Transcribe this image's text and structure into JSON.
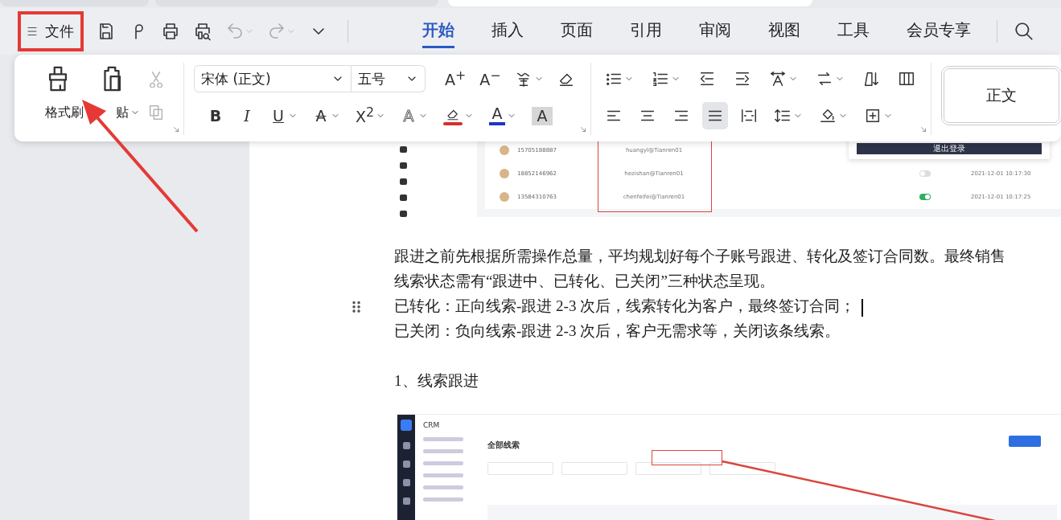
{
  "file_button": {
    "label": "文件",
    "highlighted": true
  },
  "quick_access": [
    {
      "kind": "save",
      "disabled": false
    },
    {
      "kind": "format",
      "disabled": false
    },
    {
      "kind": "print",
      "disabled": false
    },
    {
      "kind": "print-preview",
      "disabled": false
    },
    {
      "kind": "undo",
      "disabled": true,
      "menu": true
    },
    {
      "kind": "redo",
      "disabled": true,
      "menu": true
    },
    {
      "kind": "more",
      "disabled": false
    }
  ],
  "tabs": [
    {
      "label": "开始",
      "selected": true
    },
    {
      "label": "插入",
      "selected": false
    },
    {
      "label": "页面",
      "selected": false
    },
    {
      "label": "引用",
      "selected": false
    },
    {
      "label": "审阅",
      "selected": false
    },
    {
      "label": "视图",
      "selected": false
    },
    {
      "label": "工具",
      "selected": false
    },
    {
      "label": "会员专享",
      "selected": false
    }
  ],
  "ribbon": {
    "clipboard": [
      {
        "kind": "format-painter",
        "label": "格式刷"
      },
      {
        "kind": "paste",
        "label": "贴",
        "menu": true
      },
      {
        "kind": "cut",
        "disabled": true
      },
      {
        "kind": "copy",
        "disabled": true
      }
    ],
    "font": {
      "family": "宋体 (正文)",
      "size": "五号",
      "row1": [
        {
          "kind": "grow",
          "glyph": "A$^{+}$"
        },
        {
          "kind": "shrink",
          "glyph": "A$^{−}$"
        },
        {
          "kind": "pinyin",
          "menu": true
        },
        {
          "kind": "clear"
        }
      ],
      "row2": [
        {
          "kind": "bold",
          "glyph": "B"
        },
        {
          "kind": "italic",
          "glyph": "I"
        },
        {
          "kind": "underline",
          "glyph": "U",
          "menu": true
        },
        {
          "kind": "strike",
          "glyph": "A",
          "menu": true
        },
        {
          "kind": "superscript",
          "glyph": "X$^{2}$",
          "menu": true
        },
        {
          "kind": "effect",
          "glyph": "A",
          "menu": true
        },
        {
          "kind": "highlight",
          "menu": true,
          "color": "#d0312d"
        },
        {
          "kind": "font-color",
          "glyph": "A",
          "menu": true,
          "color": "#1f35c4"
        },
        {
          "kind": "shading",
          "glyph": "A"
        }
      ]
    },
    "paragraph": {
      "row1": [
        {
          "kind": "bullets",
          "menu": true
        },
        {
          "kind": "numbering",
          "menu": true
        },
        {
          "kind": "outdent"
        },
        {
          "kind": "indent"
        },
        {
          "kind": "text-direction",
          "menu": true
        },
        {
          "kind": "swap",
          "menu": true
        },
        {
          "kind": "sort"
        },
        {
          "kind": "columns"
        }
      ],
      "row2": [
        {
          "kind": "align-left",
          "selected": false
        },
        {
          "kind": "align-center",
          "selected": false
        },
        {
          "kind": "align-right",
          "selected": false
        },
        {
          "kind": "justify",
          "selected": true
        },
        {
          "kind": "distribute",
          "selected": false
        },
        {
          "kind": "line-spacing",
          "menu": true
        },
        {
          "kind": "para-shading",
          "menu": true
        },
        {
          "kind": "borders",
          "menu": true
        }
      ]
    },
    "styles": [
      {
        "label": "正文"
      }
    ]
  },
  "document": {
    "images": [
      {
        "kind": "account-list",
        "logout": "退出登录",
        "rows": [
          {
            "phone": "15705188887",
            "account": "huangyl@Tianren01"
          },
          {
            "phone": "18852146962",
            "account": "hezishan@Tianren01",
            "toggle_on": false,
            "time": "2021-12-01 10:17:30"
          },
          {
            "phone": "13584310763",
            "account": "chenfeifei@Tianren01",
            "toggle_on": true,
            "time": "2021-12-01 10:17:25"
          }
        ]
      },
      {
        "kind": "crm-page",
        "app": "CRM",
        "title": "全部线索"
      }
    ],
    "paragraphs": [
      {
        "kind": "body",
        "text": "跟进之前先根据所需操作总量，平均规划好每个子账号跟进、转化及签订合同数。最终销售"
      },
      {
        "kind": "body",
        "text": "线索状态需有“跟进中、已转化、已关闭”三种状态呈现。"
      },
      {
        "kind": "body",
        "text": "已转化：正向线索-跟进 2-3 次后，线索转化为客户，最终签订合同；",
        "cursor": true,
        "hovered": true
      },
      {
        "kind": "body",
        "text": "已关闭：负向线索-跟进 2-3 次后，客户无需求等，关闭该条线索。"
      },
      {
        "kind": "heading",
        "text": "1、线索跟进"
      }
    ]
  },
  "annotations": [
    {
      "kind": "arrow",
      "color": "#e53935"
    }
  ]
}
